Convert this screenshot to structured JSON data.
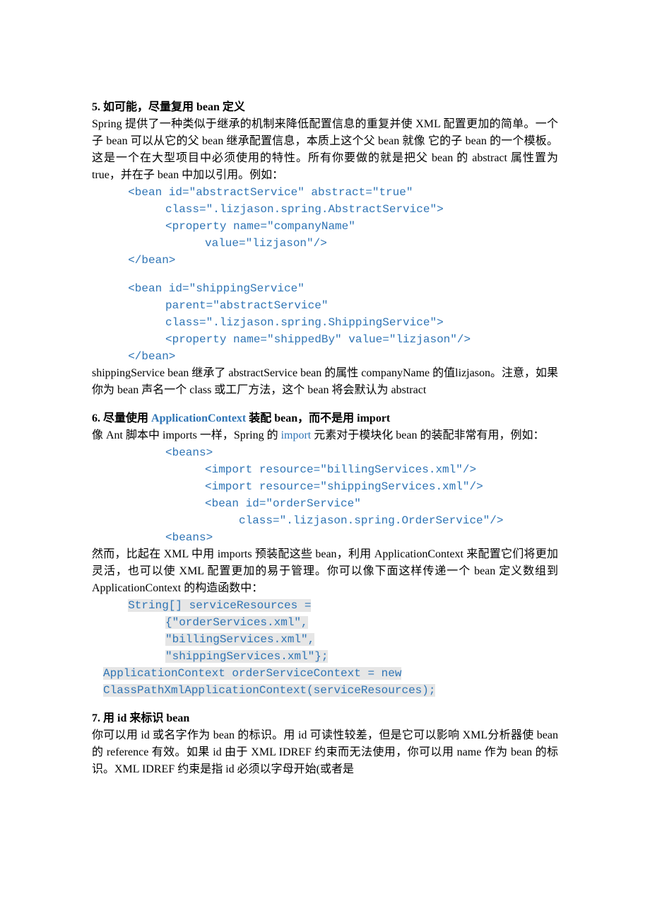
{
  "s5": {
    "heading": "5.  如可能，尽量复用 bean 定义",
    "p1": "Spring 提供了一种类似于继承的机制来降低配置信息的重复并使 XML 配置更加的简单。一个子 bean 可以从它的父 bean 继承配置信息，本质上这个父 bean 就像 它的子 bean 的一个模板。这是一个在大型项目中必须使用的特性。所有你要做的就是把父 bean 的 abstract 属性置为 true，并在子 bean 中加以引用。例如：",
    "c1": "<bean id=\"abstractService\" abstract=\"true\"",
    "c2": "class=\".lizjason.spring.AbstractService\">",
    "c3": "<property name=\"companyName\"",
    "c4": "value=\"lizjason\"/>",
    "c5": "</bean>",
    "c6": "<bean id=\"shippingService\"",
    "c7": "parent=\"abstractService\"",
    "c8": "class=\".lizjason.spring.ShippingService\">",
    "c9": "<property name=\"shippedBy\" value=\"lizjason\"/>",
    "c10": "</bean>",
    "p2": "shippingService bean 继承了 abstractService bean 的属性 companyName 的值lizjason。注意，如果你为 bean 声名一个 class 或工厂方法，这个 bean 将会默认为 abstract"
  },
  "s6": {
    "h_a": "6.  尽量使用 ",
    "h_b": "ApplicationContext",
    "h_c": " 装配 bean，而不是用 import",
    "p1a": "像 Ant 脚本中 imports 一样，Spring 的 ",
    "p1b": "import",
    "p1c": " 元素对于模块化 bean 的装配非常有用，例如：",
    "c1": "<beans>",
    "c2": "<import resource=\"billingServices.xml\"/>",
    "c3": "<import resource=\"shippingServices.xml\"/>",
    "c4": "<bean id=\"orderService\"",
    "c5": "class=\".lizjason.spring.OrderService\"/>",
    "c6": "<beans>",
    "p2": "然而，比起在 XML 中用 imports 预装配这些 bean，利用 ApplicationContext 来配置它们将更加灵活，也可以使 XML 配置更加的易于管理。你可以像下面这样传递一个 bean 定义数组到 ApplicationContext 的构造函数中：",
    "c7": "String[] serviceResources =",
    "c8": "{\"orderServices.xml\",",
    "c9": "\"billingServices.xml\",",
    "c10": "\"shippingServices.xml\"};",
    "c11": "ApplicationContext orderServiceContext = new",
    "c12": "ClassPathXmlApplicationContext(serviceResources);"
  },
  "s7": {
    "heading": "7.  用 id 来标识 bean",
    "p1": "你可以用 id 或名字作为 bean 的标识。用 id 可读性较差，但是它可以影响 XML分析器使 bean 的 reference 有效。如果 id 由于 XML IDREF 约束而无法使用，你可以用 name 作为 bean 的标识。XML IDREF 约束是指 id 必须以字母开始(或者是"
  }
}
